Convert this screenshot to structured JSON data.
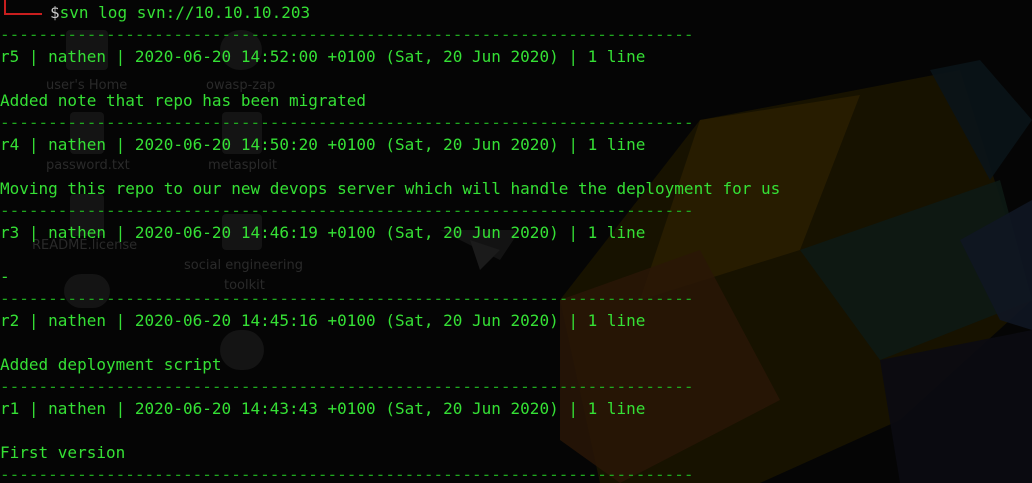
{
  "terminal": {
    "prompt_symbol": "$",
    "command": "svn log svn://10.10.10.203",
    "separator": "------------------------------------------------------------------------"
  },
  "entries": [
    {
      "header": "r5 | nathen | 2020-06-20 14:52:00 +0100 (Sat, 20 Jun 2020) | 1 line",
      "message": "Added note that repo has been migrated"
    },
    {
      "header": "r4 | nathen | 2020-06-20 14:50:20 +0100 (Sat, 20 Jun 2020) | 1 line",
      "message": "Moving this repo to our new devops server which will handle the deployment for us"
    },
    {
      "header": "r3 | nathen | 2020-06-20 14:46:19 +0100 (Sat, 20 Jun 2020) | 1 line",
      "message": "-"
    },
    {
      "header": "r2 | nathen | 2020-06-20 14:45:16 +0100 (Sat, 20 Jun 2020) | 1 line",
      "message": "Added deployment script"
    },
    {
      "header": "r1 | nathen | 2020-06-20 14:43:43 +0100 (Sat, 20 Jun 2020) | 1 line",
      "message": "First version"
    }
  ],
  "desktop": {
    "icon_labels": [
      "user's Home",
      "owasp-zap",
      "password.txt",
      "metasploit",
      "README.license",
      "social engineering",
      "toolkit"
    ]
  },
  "colors": {
    "terminal_text": "#35e035",
    "separator": "#1fa81f",
    "prompt_corner": "#c81e1e",
    "background": "#050505"
  }
}
